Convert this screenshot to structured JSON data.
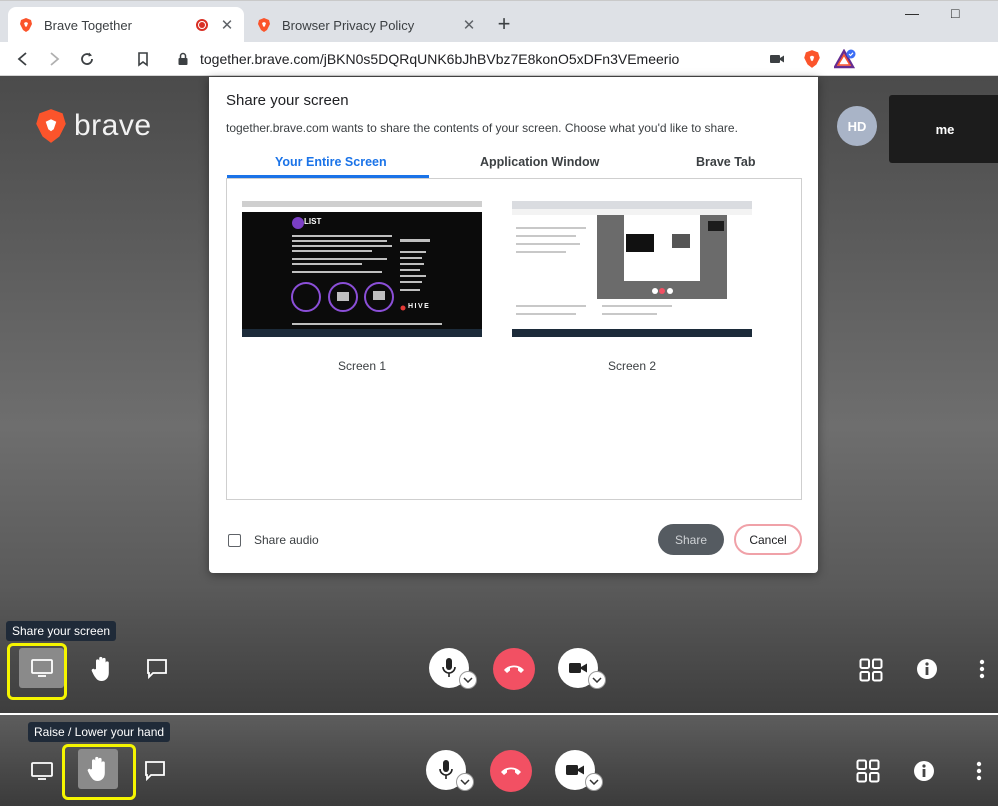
{
  "browser": {
    "tabs": [
      {
        "title": "Brave Together",
        "recording": true
      },
      {
        "title": "Browser Privacy Policy",
        "recording": false
      }
    ],
    "url": "together.brave.com/jBKN0s5DQRqUNK6bJhBVbz7E8konO5xDFn3VEmeerio",
    "window_minimize": "—",
    "window_maximize": "□",
    "new_tab": "+",
    "tab_close": "✕"
  },
  "meeting": {
    "logo_text": "brave",
    "participant_initials": "HD",
    "self_label": "me"
  },
  "dialog": {
    "title": "Share your screen",
    "subtitle": "together.brave.com wants to share the contents of your screen. Choose what you'd like to share.",
    "tabs": [
      "Your Entire Screen",
      "Application Window",
      "Brave Tab"
    ],
    "active_tab": "Your Entire Screen",
    "screens": [
      {
        "label": "Screen 1",
        "content_text": "HIVE",
        "logo_text": "LIST"
      },
      {
        "label": "Screen 2"
      }
    ],
    "share_audio_label": "Share audio",
    "share_button": "Share",
    "cancel_button": "Cancel"
  },
  "toolbar_top": {
    "tooltip": "Share your screen"
  },
  "toolbar_bottom": {
    "tooltip": "Raise / Lower your hand"
  },
  "colors": {
    "accent": "#1a73e8",
    "hangup": "#f25063",
    "highlight": "#f5f500",
    "brave_orange": "#fb542b"
  }
}
